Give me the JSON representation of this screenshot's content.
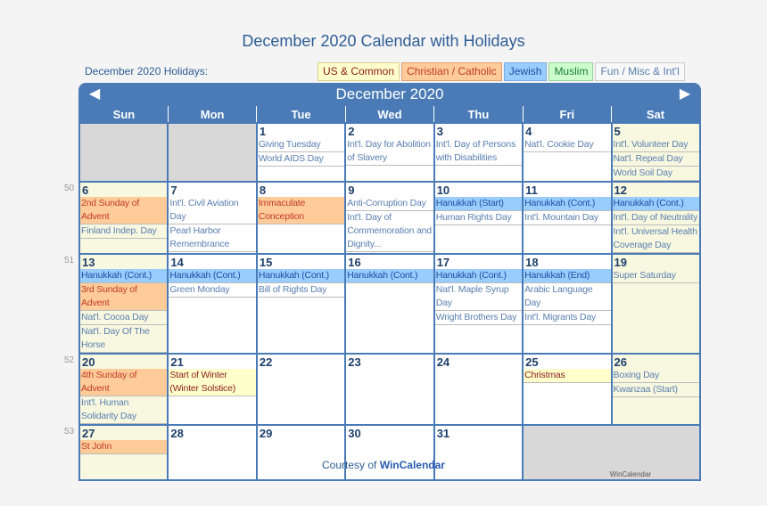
{
  "title": "December 2020 Calendar with Holidays",
  "holidays_label": "December 2020 Holidays:",
  "legend": [
    {
      "key": "us",
      "label": "US & Common",
      "color": "#ffffcc"
    },
    {
      "key": "ch",
      "label": "Christian / Catholic",
      "color": "#ffcc99"
    },
    {
      "key": "je",
      "label": "Jewish",
      "color": "#99ccff"
    },
    {
      "key": "mu",
      "label": "Muslim",
      "color": "#ccffcc"
    },
    {
      "key": "fu",
      "label": "Fun / Misc & Int'l",
      "color": "#f8f8f8"
    }
  ],
  "calendar": {
    "month_label": "December 2020",
    "prev_icon": "triangle-left-icon",
    "next_icon": "triangle-right-icon",
    "weekdays": [
      "Sun",
      "Mon",
      "Tue",
      "Wed",
      "Thu",
      "Fri",
      "Sat"
    ],
    "weeks": [
      {
        "week_number": "",
        "days": [
          {
            "empty": true
          },
          {
            "empty": true
          },
          {
            "day": "1",
            "events": [
              {
                "t": "Giving Tuesday",
                "c": "fu"
              },
              {
                "t": "World AIDS Day",
                "c": "fu"
              }
            ]
          },
          {
            "day": "2",
            "events": [
              {
                "t": "Int'l. Day for Abolition of Slavery",
                "c": "fu"
              }
            ]
          },
          {
            "day": "3",
            "events": [
              {
                "t": "Int'l. Day of Persons with Disabilities",
                "c": "fu"
              }
            ]
          },
          {
            "day": "4",
            "events": [
              {
                "t": "Nat'l. Cookie Day",
                "c": "fu"
              }
            ]
          },
          {
            "day": "5",
            "events": [
              {
                "t": "Int'l. Volunteer Day",
                "c": "fu"
              },
              {
                "t": "Nat'l. Repeal Day",
                "c": "fu"
              },
              {
                "t": "World Soil Day",
                "c": "fu"
              }
            ]
          }
        ]
      },
      {
        "week_number": "50",
        "days": [
          {
            "day": "6",
            "events": [
              {
                "t": "2nd Sunday of Advent",
                "c": "ch"
              },
              {
                "t": "Finland Indep. Day",
                "c": "fu"
              }
            ]
          },
          {
            "day": "7",
            "events": [
              {
                "t": "Int'l. Civil Aviation Day",
                "c": "fu"
              },
              {
                "t": "Pearl Harbor Remembrance",
                "c": "fu"
              }
            ]
          },
          {
            "day": "8",
            "events": [
              {
                "t": "Immaculate Conception",
                "c": "ch"
              }
            ]
          },
          {
            "day": "9",
            "events": [
              {
                "t": "Anti-Corruption Day",
                "c": "fu"
              },
              {
                "t": "Int'l. Day of Commemoration and Dignity...",
                "c": "fu"
              }
            ]
          },
          {
            "day": "10",
            "events": [
              {
                "t": "Hanukkah (Start)",
                "c": "je"
              },
              {
                "t": "Human Rights Day",
                "c": "fu"
              }
            ]
          },
          {
            "day": "11",
            "events": [
              {
                "t": "Hanukkah (Cont.)",
                "c": "je"
              },
              {
                "t": "Int'l. Mountain Day",
                "c": "fu"
              }
            ]
          },
          {
            "day": "12",
            "events": [
              {
                "t": "Hanukkah (Cont.)",
                "c": "je"
              },
              {
                "t": "Int'l. Day of Neutrality",
                "c": "fu"
              },
              {
                "t": "Int'l. Universal Health Coverage Day",
                "c": "fu"
              }
            ]
          }
        ]
      },
      {
        "week_number": "51",
        "days": [
          {
            "day": "13",
            "events": [
              {
                "t": "Hanukkah (Cont.)",
                "c": "je"
              },
              {
                "t": "3rd Sunday of Advent",
                "c": "ch"
              },
              {
                "t": "Nat'l. Cocoa Day",
                "c": "fu"
              },
              {
                "t": "Nat'l. Day Of The Horse",
                "c": "fu"
              }
            ]
          },
          {
            "day": "14",
            "events": [
              {
                "t": "Hanukkah (Cont.)",
                "c": "je"
              },
              {
                "t": "Green Monday",
                "c": "fu"
              }
            ]
          },
          {
            "day": "15",
            "events": [
              {
                "t": "Hanukkah (Cont.)",
                "c": "je"
              },
              {
                "t": "Bill of Rights Day",
                "c": "fu"
              }
            ]
          },
          {
            "day": "16",
            "events": [
              {
                "t": "Hanukkah (Cont.)",
                "c": "je"
              }
            ]
          },
          {
            "day": "17",
            "events": [
              {
                "t": "Hanukkah (Cont.)",
                "c": "je"
              },
              {
                "t": "Nat'l. Maple Syrup Day",
                "c": "fu"
              },
              {
                "t": "Wright Brothers Day",
                "c": "fu"
              }
            ]
          },
          {
            "day": "18",
            "events": [
              {
                "t": "Hanukkah (End)",
                "c": "je"
              },
              {
                "t": "Arabic Language Day",
                "c": "fu"
              },
              {
                "t": "Int'l. Migrants Day",
                "c": "fu"
              }
            ]
          },
          {
            "day": "19",
            "events": [
              {
                "t": "Super Saturday",
                "c": "fu"
              }
            ]
          }
        ]
      },
      {
        "week_number": "52",
        "days": [
          {
            "day": "20",
            "events": [
              {
                "t": "4th Sunday of Advent",
                "c": "ch"
              },
              {
                "t": "Int'l. Human Solidarity Day",
                "c": "fu"
              }
            ]
          },
          {
            "day": "21",
            "events": [
              {
                "t": "Start of Winter (Winter Solstice)",
                "c": "us"
              }
            ]
          },
          {
            "day": "22",
            "events": []
          },
          {
            "day": "23",
            "events": []
          },
          {
            "day": "24",
            "events": []
          },
          {
            "day": "25",
            "events": [
              {
                "t": "Christmas",
                "c": "us"
              }
            ]
          },
          {
            "day": "26",
            "events": [
              {
                "t": "Boxing Day",
                "c": "fu"
              },
              {
                "t": "Kwanzaa (Start)",
                "c": "fu"
              }
            ]
          }
        ]
      },
      {
        "week_number": "53",
        "days": [
          {
            "day": "27",
            "events": [
              {
                "t": "St John",
                "c": "ch"
              }
            ]
          },
          {
            "day": "28",
            "events": []
          },
          {
            "day": "29",
            "events": []
          },
          {
            "day": "30",
            "events": []
          },
          {
            "day": "31",
            "events": []
          },
          {
            "empty": true,
            "span": 2,
            "watermark": "WinCalendar"
          }
        ]
      }
    ]
  },
  "footer": {
    "prefix": "Courtesy of ",
    "link": "WinCalendar"
  }
}
